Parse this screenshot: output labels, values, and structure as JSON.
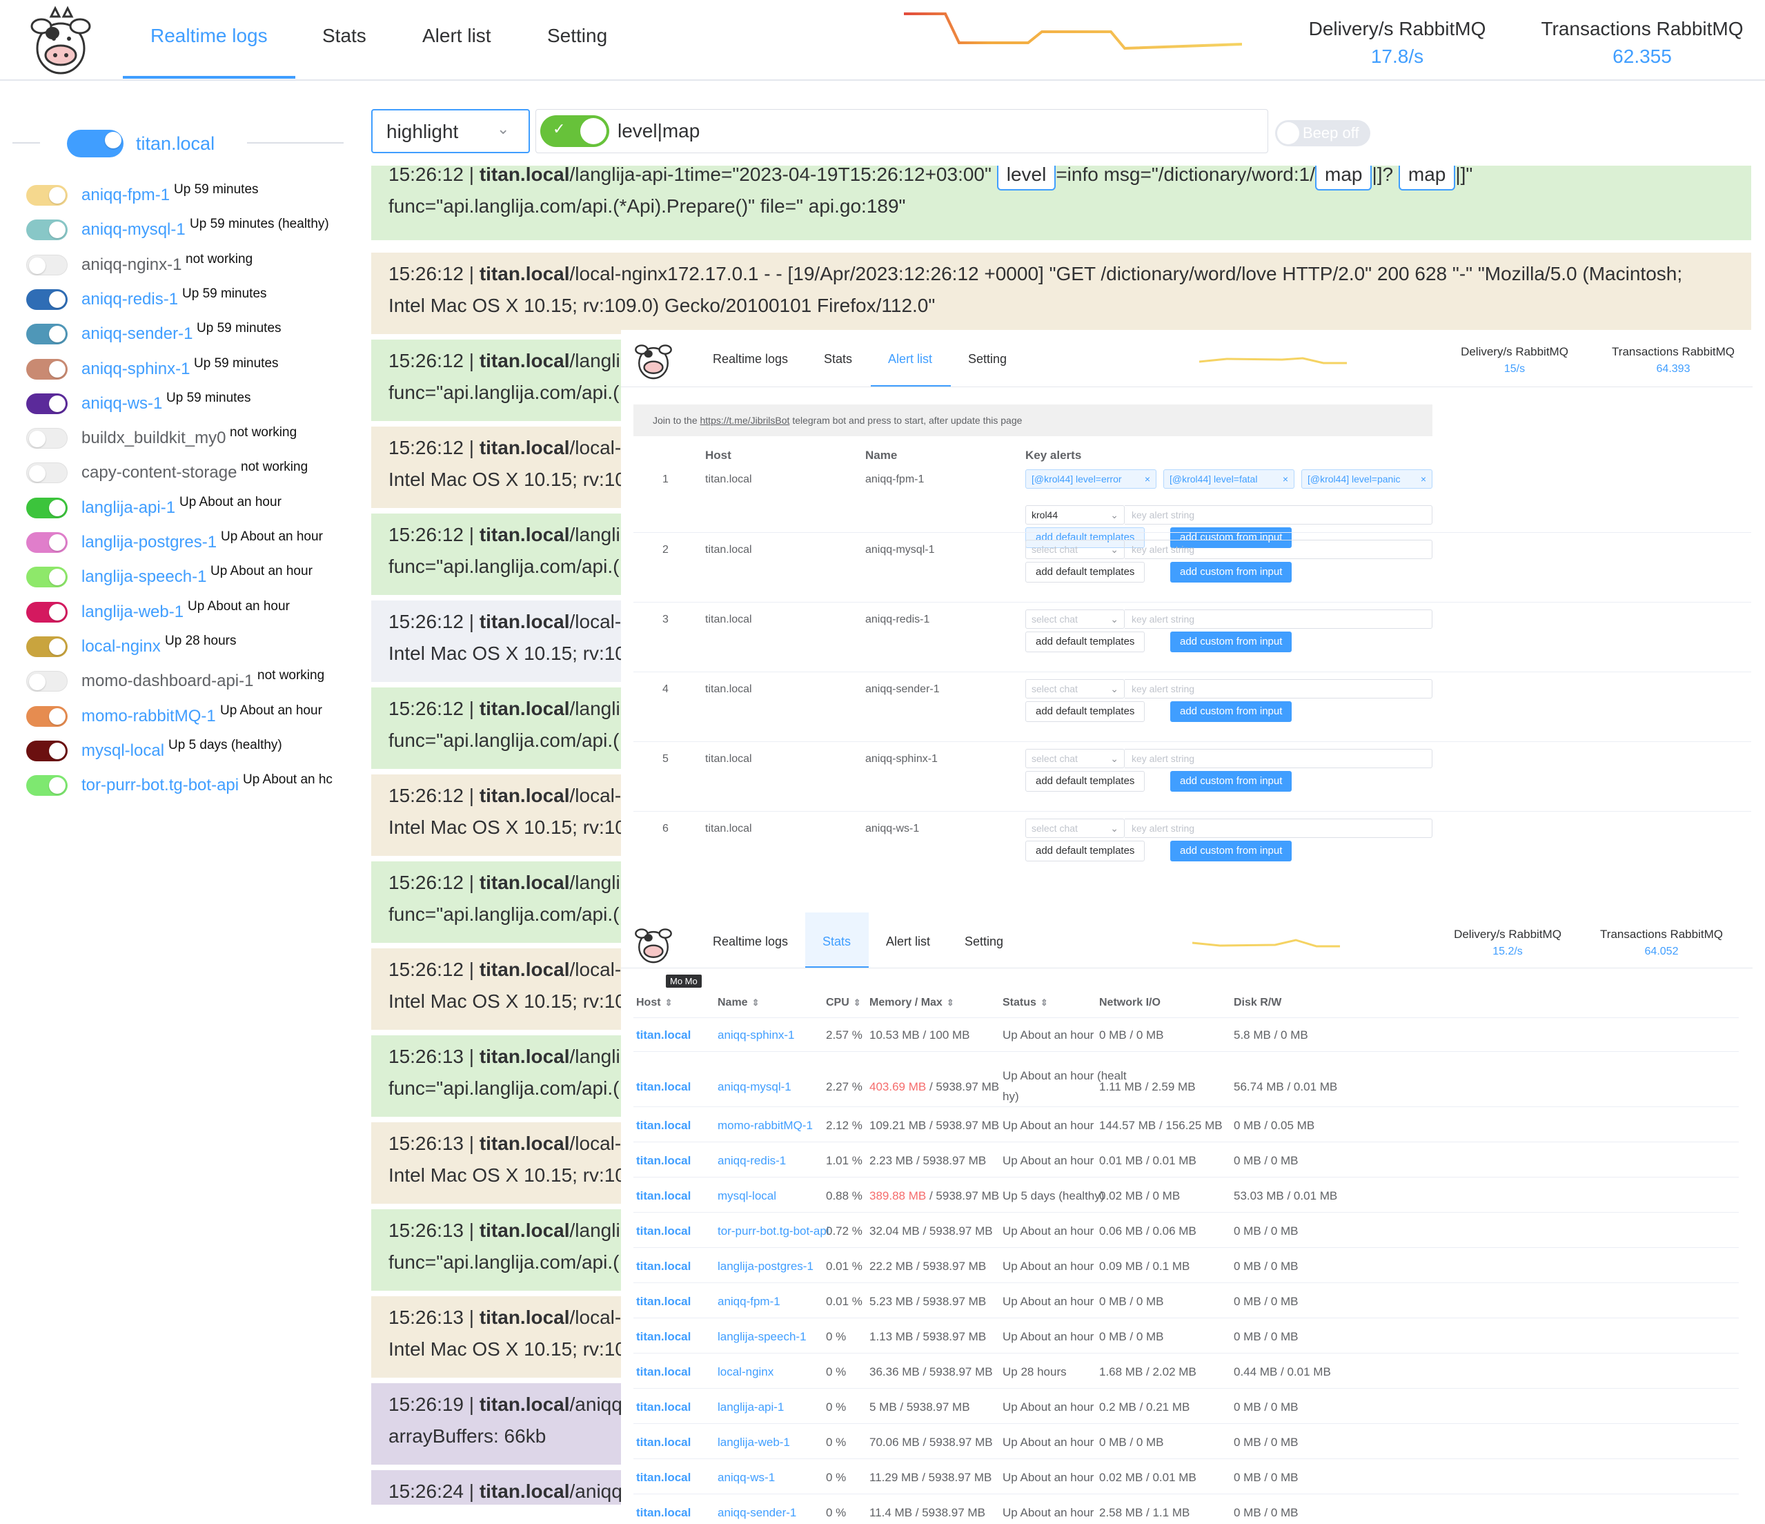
{
  "header": {
    "tabs": [
      "Realtime logs",
      "Stats",
      "Alert list",
      "Setting"
    ],
    "active_tab": "Realtime logs",
    "metrics": [
      {
        "title": "Delivery/s RabbitMQ",
        "value": "17.8/s"
      },
      {
        "title": "Transactions RabbitMQ",
        "value": "62.355"
      }
    ]
  },
  "sidebar": {
    "host": "titan.local",
    "containers": [
      {
        "name": "aniqq-fpm-1",
        "status": "Up 59 minutes",
        "on": true,
        "color": "#f5d88e"
      },
      {
        "name": "aniqq-mysql-1",
        "status": "Up 59 minutes (healthy)",
        "on": true,
        "color": "#88c7c7"
      },
      {
        "name": "aniqq-nginx-1",
        "status": "not working",
        "on": false,
        "color": "#eeeeee"
      },
      {
        "name": "aniqq-redis-1",
        "status": "Up 59 minutes",
        "on": true,
        "color": "#2f6db5"
      },
      {
        "name": "aniqq-sender-1",
        "status": "Up 59 minutes",
        "on": true,
        "color": "#4f97b8"
      },
      {
        "name": "aniqq-sphinx-1",
        "status": "Up 59 minutes",
        "on": true,
        "color": "#c98a72"
      },
      {
        "name": "aniqq-ws-1",
        "status": "Up 59 minutes",
        "on": true,
        "color": "#5b2a9a"
      },
      {
        "name": "buildx_buildkit_my0",
        "status": "not working",
        "on": false,
        "color": "#eeeeee"
      },
      {
        "name": "capy-content-storage",
        "status": "not working",
        "on": false,
        "color": "#eeeeee"
      },
      {
        "name": "langlija-api-1",
        "status": "Up About an hour",
        "on": true,
        "color": "#3cc43c"
      },
      {
        "name": "langlija-postgres-1",
        "status": "Up About an hour",
        "on": true,
        "color": "#e07ecb"
      },
      {
        "name": "langlija-speech-1",
        "status": "Up About an hour",
        "on": true,
        "color": "#8ee86a"
      },
      {
        "name": "langlija-web-1",
        "status": "Up About an hour",
        "on": true,
        "color": "#d4195f"
      },
      {
        "name": "local-nginx",
        "status": "Up 28 hours",
        "on": true,
        "color": "#c9a43e"
      },
      {
        "name": "momo-dashboard-api-1",
        "status": "not working",
        "on": false,
        "color": "#eeeeee"
      },
      {
        "name": "momo-rabbitMQ-1",
        "status": "Up About an hour",
        "on": true,
        "color": "#e68c50"
      },
      {
        "name": "mysql-local",
        "status": "Up 5 days (healthy)",
        "on": true,
        "color": "#6b1010"
      },
      {
        "name": "tor-purr-bot.tg-bot-api",
        "status": "Up About an hc",
        "on": true,
        "color": "#7ee870"
      }
    ]
  },
  "filter": {
    "mode": "highlight",
    "query": "level|map",
    "beep": "Beep off"
  },
  "logs": {
    "rows": [
      {
        "line1_pre": "15:26:12 | ",
        "host": "titan.local",
        "line1_rest": "/langlija-api-1time=\"2023-04-19T15:26:12+03:00\"",
        "line2": "func=\"api.langlija.com/api.(*Api).Prepare()\" file=\" api.go:189\"",
        "bg": "#dbf0d4"
      },
      {
        "line1_pre": "15:26:12 | ",
        "host": "titan.local",
        "line1_rest": "/local-nginx172.17.0.1 - - [19/Apr/2023:12:26:12 +0000] \"GET /dictionary/word/love HTTP/2.0\" 200 628 \"-\" \"Mozilla/5.0 (Macintosh;",
        "line2": "Intel Mac OS X 10.15; rv:109.0) Gecko/20100101 Firefox/112.0\"",
        "bg": "#f3ecdc"
      },
      {
        "line1_pre": "15:26:12 | ",
        "host": "titan.local",
        "line1_rest": "/langli",
        "line2": "func=\"api.langlija.com/api.(",
        "bg": "#dbf0d4"
      },
      {
        "line1_pre": "15:26:12 | ",
        "host": "titan.local",
        "line1_rest": "/local-",
        "line2": "Intel Mac OS X 10.15; rv:10",
        "bg": "#f3ecdc"
      },
      {
        "line1_pre": "15:26:12 | ",
        "host": "titan.local",
        "line1_rest": "/langli",
        "line2": "func=\"api.langlija.com/api.(",
        "bg": "#dbf0d4"
      },
      {
        "line1_pre": "15:26:12 | ",
        "host": "titan.local",
        "line1_rest": "/local-",
        "line2": "Intel Mac OS X 10.15; rv:10",
        "bg": "#eef0f5"
      },
      {
        "line1_pre": "15:26:12 | ",
        "host": "titan.local",
        "line1_rest": "/langli",
        "line2": "func=\"api.langlija.com/api.(",
        "bg": "#dbf0d4"
      },
      {
        "line1_pre": "15:26:12 | ",
        "host": "titan.local",
        "line1_rest": "/local-",
        "line2": "Intel Mac OS X 10.15; rv:10",
        "bg": "#f3ecdc"
      },
      {
        "line1_pre": "15:26:12 | ",
        "host": "titan.local",
        "line1_rest": "/langli",
        "line2": "func=\"api.langlija.com/api.(",
        "bg": "#dbf0d4"
      },
      {
        "line1_pre": "15:26:12 | ",
        "host": "titan.local",
        "line1_rest": "/local-",
        "line2": "Intel Mac OS X 10.15; rv:10",
        "bg": "#f3ecdc"
      },
      {
        "line1_pre": "15:26:13 | ",
        "host": "titan.local",
        "line1_rest": "/langli",
        "line2": "func=\"api.langlija.com/api.(",
        "bg": "#dbf0d4"
      },
      {
        "line1_pre": "15:26:13 | ",
        "host": "titan.local",
        "line1_rest": "/local-",
        "line2": "Intel Mac OS X 10.15; rv:10",
        "bg": "#f3ecdc"
      },
      {
        "line1_pre": "15:26:13 | ",
        "host": "titan.local",
        "line1_rest": "/langli",
        "line2": "func=\"api.langlija.com/api.(",
        "bg": "#dbf0d4"
      },
      {
        "line1_pre": "15:26:13 | ",
        "host": "titan.local",
        "line1_rest": "/local-",
        "line2": "Intel Mac OS X 10.15; rv:10",
        "bg": "#f3ecdc"
      },
      {
        "line1_pre": "15:26:19 | ",
        "host": "titan.local",
        "line1_rest": "/aniqq",
        "line2": "arrayBuffers: 66kb",
        "bg": "#ddd6e8"
      },
      {
        "line1_pre": "15:26:24 | ",
        "host": "titan.local",
        "line1_rest": "/aniqq",
        "line2": "",
        "bg": "#ddd6e8"
      }
    ],
    "first_row_tail": "=info msg=\"/dictionary/word:1/",
    "first_row_tail2": "|]?",
    "first_row_tail3": "|]\"",
    "highlights": [
      "level",
      "map",
      "map"
    ]
  },
  "alert_panel": {
    "tabs": [
      "Realtime logs",
      "Stats",
      "Alert list",
      "Setting"
    ],
    "active_tab": "Alert list",
    "metrics": [
      {
        "title": "Delivery/s RabbitMQ",
        "value": "15/s"
      },
      {
        "title": "Transactions RabbitMQ",
        "value": "64.393"
      }
    ],
    "notice_pre": "Join to the ",
    "notice_link": "https://t.me/JibrilsBot",
    "notice_post": " telegram bot and press to start, after update this page",
    "columns": [
      "Host",
      "Name",
      "Key alerts"
    ],
    "rows": [
      {
        "num": "1",
        "host": "titan.local",
        "name": "aniqq-fpm-1",
        "chat": "krol44",
        "tags": [
          "[@krol44] level=error",
          "[@krol44] level=fatal",
          "[@krol44] level=panic"
        ]
      },
      {
        "num": "2",
        "host": "titan.local",
        "name": "aniqq-mysql-1",
        "chat": "select chat",
        "tags": []
      },
      {
        "num": "3",
        "host": "titan.local",
        "name": "aniqq-redis-1",
        "chat": "select chat",
        "tags": []
      },
      {
        "num": "4",
        "host": "titan.local",
        "name": "aniqq-sender-1",
        "chat": "select chat",
        "tags": []
      },
      {
        "num": "5",
        "host": "titan.local",
        "name": "aniqq-sphinx-1",
        "chat": "select chat",
        "tags": []
      },
      {
        "num": "6",
        "host": "titan.local",
        "name": "aniqq-ws-1",
        "chat": "select chat",
        "tags": []
      }
    ],
    "input_placeholder": "key alert string",
    "btn_default": "add default templates",
    "btn_custom": "add custom from input"
  },
  "stats_panel": {
    "tabs": [
      "Realtime logs",
      "Stats",
      "Alert list",
      "Setting"
    ],
    "active_tab": "Stats",
    "tooltip": "Mo Mo",
    "metrics": [
      {
        "title": "Delivery/s RabbitMQ",
        "value": "15.2/s"
      },
      {
        "title": "Transactions RabbitMQ",
        "value": "64.052"
      }
    ],
    "columns": [
      "Host",
      "Name",
      "CPU",
      "Memory / Max",
      "Status",
      "Network I/O",
      "Disk R/W"
    ],
    "sort_icon": "⇕",
    "rows": [
      {
        "host": "titan.local",
        "name": "aniqq-sphinx-1",
        "cpu": "2.57 %",
        "mem": "10.53 MB",
        "max": " / 100 MB",
        "mem_red": false,
        "status": "Up About an hour",
        "status2": "",
        "net": "0 MB / 0 MB",
        "disk": "5.8 MB / 0 MB"
      },
      {
        "host": "titan.local",
        "name": "aniqq-mysql-1",
        "cpu": "2.27 %",
        "mem": "403.69 MB",
        "max": " / 5938.97 MB",
        "mem_red": true,
        "status": "Up About an hour (healt",
        "status2": "hy)",
        "net": "1.11 MB / 2.59 MB",
        "disk": "56.74 MB / 0.01 MB"
      },
      {
        "host": "titan.local",
        "name": "momo-rabbitMQ-1",
        "cpu": "2.12 %",
        "mem": "109.21 MB",
        "max": " / 5938.97 MB",
        "mem_red": false,
        "status": "Up About an hour",
        "status2": "",
        "net": "144.57 MB / 156.25 MB",
        "disk": "0 MB / 0.05 MB"
      },
      {
        "host": "titan.local",
        "name": "aniqq-redis-1",
        "cpu": "1.01 %",
        "mem": "2.23 MB",
        "max": " / 5938.97 MB",
        "mem_red": false,
        "status": "Up About an hour",
        "status2": "",
        "net": "0.01 MB / 0.01 MB",
        "disk": "0 MB / 0 MB"
      },
      {
        "host": "titan.local",
        "name": "mysql-local",
        "cpu": "0.88 %",
        "mem": "389.88 MB",
        "max": " / 5938.97 MB",
        "mem_red": true,
        "status": "Up 5 days (healthy)",
        "status2": "",
        "net": "0.02 MB / 0 MB",
        "disk": "53.03 MB / 0.01 MB"
      },
      {
        "host": "titan.local",
        "name": "tor-purr-bot.tg-bot-api",
        "cpu": "0.72 %",
        "mem": "32.04 MB",
        "max": " / 5938.97 MB",
        "mem_red": false,
        "status": "Up About an hour",
        "status2": "",
        "net": "0.06 MB / 0.06 MB",
        "disk": "0 MB / 0 MB"
      },
      {
        "host": "titan.local",
        "name": "langlija-postgres-1",
        "cpu": "0.01 %",
        "mem": "22.2 MB",
        "max": " / 5938.97 MB",
        "mem_red": false,
        "status": "Up About an hour",
        "status2": "",
        "net": "0.09 MB / 0.1 MB",
        "disk": "0 MB / 0 MB"
      },
      {
        "host": "titan.local",
        "name": "aniqq-fpm-1",
        "cpu": "0.01 %",
        "mem": "5.23 MB",
        "max": " / 5938.97 MB",
        "mem_red": false,
        "status": "Up About an hour",
        "status2": "",
        "net": "0 MB / 0 MB",
        "disk": "0 MB / 0 MB"
      },
      {
        "host": "titan.local",
        "name": "langlija-speech-1",
        "cpu": "0 %",
        "mem": "1.13 MB",
        "max": " / 5938.97 MB",
        "mem_red": false,
        "status": "Up About an hour",
        "status2": "",
        "net": "0 MB / 0 MB",
        "disk": "0 MB / 0 MB"
      },
      {
        "host": "titan.local",
        "name": "local-nginx",
        "cpu": "0 %",
        "mem": "36.36 MB",
        "max": " / 5938.97 MB",
        "mem_red": false,
        "status": "Up 28 hours",
        "status2": "",
        "net": "1.68 MB / 2.02 MB",
        "disk": "0.44 MB / 0.01 MB"
      },
      {
        "host": "titan.local",
        "name": "langlija-api-1",
        "cpu": "0 %",
        "mem": "5 MB",
        "max": " / 5938.97 MB",
        "mem_red": false,
        "status": "Up About an hour",
        "status2": "",
        "net": "0.2 MB / 0.21 MB",
        "disk": "0 MB / 0 MB"
      },
      {
        "host": "titan.local",
        "name": "langlija-web-1",
        "cpu": "0 %",
        "mem": "70.06 MB",
        "max": " / 5938.97 MB",
        "mem_red": false,
        "status": "Up About an hour",
        "status2": "",
        "net": "0 MB / 0 MB",
        "disk": "0 MB / 0 MB"
      },
      {
        "host": "titan.local",
        "name": "aniqq-ws-1",
        "cpu": "0 %",
        "mem": "11.29 MB",
        "max": " / 5938.97 MB",
        "mem_red": false,
        "status": "Up About an hour",
        "status2": "",
        "net": "0.02 MB / 0.01 MB",
        "disk": "0 MB / 0 MB"
      },
      {
        "host": "titan.local",
        "name": "aniqq-sender-1",
        "cpu": "0 %",
        "mem": "11.4 MB",
        "max": " / 5938.97 MB",
        "mem_red": false,
        "status": "Up About an hour",
        "status2": "",
        "net": "2.58 MB / 1.1 MB",
        "disk": "0 MB / 0 MB"
      }
    ]
  }
}
